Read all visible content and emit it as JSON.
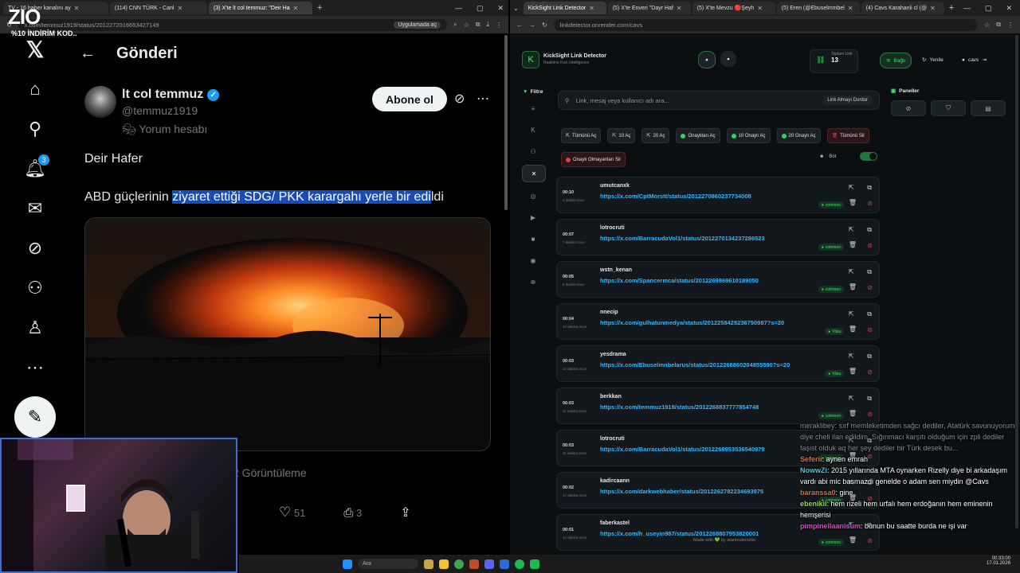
{
  "left_browser": {
    "tabs": [
      {
        "label": "TV - 16 haber kanalını ay"
      },
      {
        "label": "(114) CNN TÜRK - Canl"
      },
      {
        "label": "(3) X'te lt col temmuz: \"Deir Ha"
      }
    ],
    "url": "x.com/temmuz1919/status/2012272016653427149",
    "open_in_app": "Uygulamada aç",
    "nav": {
      "notifications_count": "3"
    },
    "header_title": "Gönderi",
    "author": {
      "name": "lt col temmuz",
      "handle": "@temmuz1919",
      "label": "Yorum hesabı"
    },
    "follow_label": "Abone ol",
    "tweet_line1": "Deir Hafer",
    "tweet_line2_pre": "ABD güçlerinin ",
    "tweet_line2_hl": "ziyaret ettiği SDG/ PKK karargahı yerle bir edi",
    "tweet_line2_post": "ldi",
    "views": "2 Görüntüleme",
    "likes": "51",
    "bookmarks": "3"
  },
  "overlay": {
    "logo": "ZIO",
    "promo": "%10 İNDİRİM KOD.."
  },
  "right_browser": {
    "tabs": [
      {
        "label": "KickSight Link Detector"
      },
      {
        "label": "(5) X'te Enveri \"Dayr Haf"
      },
      {
        "label": "(5) X'te Mevzu 🔴Şeyh"
      },
      {
        "label": "(5) Eren (@Ebuselmmbel"
      },
      {
        "label": "(4) Cavs Karahanli cl (@"
      }
    ],
    "url": "linkdetector.onrender.com/cavs",
    "app_title": "KickSight Link Detector",
    "app_subtitle": "Realtime Kick Intelligence",
    "total_links_label": "Toplam Link",
    "total_links": "13",
    "connected": "Bağlı",
    "refresh": "Yenile",
    "user": "cavs",
    "filter_label": "Filtre",
    "panels_label": "Paneller",
    "search_placeholder": "Link, mesaj veya kullanıcı adı ara...",
    "stop_button": "Link Almayı Durdur",
    "quick_buttons": [
      "Tümünü Aç",
      "10 Aç",
      "20 Aç",
      "Onaylıları Aç",
      "10 Onaylı Aç",
      "20 Onaylı Aç",
      "Tümünü Sil",
      "Onaylı Olmayanları Sil"
    ],
    "bot_label": "Bot",
    "links": [
      {
        "time": "00:10",
        "ago": "4 dakika önce",
        "user": "umutcanxk",
        "url": "https://x.com/CptMorstt/status/2012270860237734008",
        "tag": "cotmoon"
      },
      {
        "time": "00:07",
        "ago": "7 dakika önce",
        "user": "lotrocruti",
        "url": "https://x.com/BarracudaVol1/status/2012270134237286523",
        "tag": "cotmoon"
      },
      {
        "time": "00:05",
        "ago": "9 dakika önce",
        "user": "wstn_kenan",
        "url": "https://x.com/Spancermca/status/2012269869610189050",
        "tag": "cotmoon"
      },
      {
        "time": "00:04",
        "ago": "10 dakika önce",
        "user": "nnecip",
        "url": "https://x.com/gulhatunmedya/status/2012258428236750987?s=20",
        "tag": "Vlisa"
      },
      {
        "time": "00:03",
        "ago": "10 dakika önce",
        "user": "yesdrama",
        "url": "https://x.com/Ebuselmnbelarus/status/2012268860204855590?s=20",
        "tag": "Vlisa"
      },
      {
        "time": "00:03",
        "ago": "11 dakika önce",
        "user": "berkkan",
        "url": "https://x.com/temmuz1919/status/2012268837777854748",
        "tag": "cotmoon"
      },
      {
        "time": "00:03",
        "ago": "11 dakika önce",
        "user": "lotrocruti",
        "url": "https://x.com/BarracudaVol1/status/2012268953536540979",
        "tag": "cotmoon"
      },
      {
        "time": "00:02",
        "ago": "12 dakika önce",
        "user": "kadircaann",
        "url": "https://x.com/darkwebhaber/status/2012262782234693975",
        "tag": "cotmoon"
      },
      {
        "time": "00:01",
        "ago": "13 dakika önce",
        "user": "faberkastel",
        "url": "https://x.com/h_useyin987/status/2012268807953820001",
        "tag": "cotmoon"
      }
    ],
    "footer": "Made with 💚 by atarimukendisi"
  },
  "chat": [
    {
      "user": "meraklibey",
      "text": ": sırf memleketimden sağcı dediler, Atatürk savunuyorum diye cheli ilan edildim. Sığınmacı karşıtı olduğum için zpli dediler faşist olduk aq her şey dediler bir Türk desek bu...",
      "style": "dim"
    },
    {
      "user": "Seferii",
      "text": ": aynen emrah",
      "style": "u1"
    },
    {
      "user": "NowwZi",
      "text": ": 2015 yıllarında MTA oynarken Rizelly diye bi arkadaşım vardı abi mic basmazdi genelde o adam sen miydin @Cavs",
      "style": "u2"
    },
    {
      "user": "baranssa0",
      "text": ": gine",
      "style": "u1"
    },
    {
      "user": "ebenikii",
      "text": ": hem rizeli hem urfalı hem erdoğanın hem eminenin hemşerisi",
      "style": "u3"
    },
    {
      "user": "pimpinellaanisum",
      "text": ": bunun bu saatte burda ne işi var",
      "style": "u4"
    }
  ],
  "taskbar": {
    "search": "Ara",
    "time": "00:33:00",
    "date": "17.01.2026"
  }
}
